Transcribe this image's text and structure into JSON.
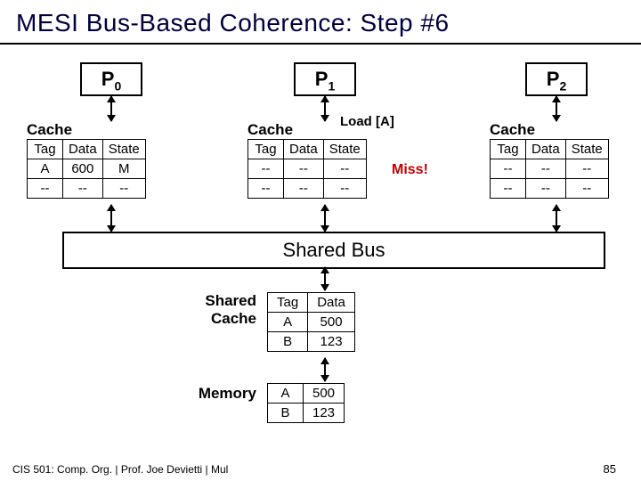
{
  "title": "MESI Bus-Based Coherence: Step #6",
  "processors": [
    {
      "name": "P",
      "sub": "0"
    },
    {
      "name": "P",
      "sub": "1"
    },
    {
      "name": "P",
      "sub": "2"
    }
  ],
  "cache_label": "Cache",
  "cache_headers": [
    "Tag",
    "Data",
    "State"
  ],
  "caches": {
    "p0": [
      {
        "tag": "A",
        "data": "600",
        "state": "M"
      },
      {
        "tag": "--",
        "data": "--",
        "state": "--"
      }
    ],
    "p1": [
      {
        "tag": "--",
        "data": "--",
        "state": "--"
      },
      {
        "tag": "--",
        "data": "--",
        "state": "--"
      }
    ],
    "p2": [
      {
        "tag": "--",
        "data": "--",
        "state": "--"
      },
      {
        "tag": "--",
        "data": "--",
        "state": "--"
      }
    ]
  },
  "load_annotation": "Load [A]",
  "miss_annotation": "Miss!",
  "bus_label": "Shared Bus",
  "shared_cache_label_line1": "Shared",
  "shared_cache_label_line2": "Cache",
  "memory_label": "Memory",
  "shared_cache_headers": [
    "Tag",
    "Data"
  ],
  "shared_cache_rows": [
    {
      "tag": "A",
      "data": "500"
    },
    {
      "tag": "B",
      "data": "123"
    }
  ],
  "memory_rows": [
    {
      "tag": "A",
      "data": "500"
    },
    {
      "tag": "B",
      "data": "123"
    }
  ],
  "footer": "CIS 501: Comp. Org. | Prof. Joe Devietti | Mul",
  "page_number": "85"
}
